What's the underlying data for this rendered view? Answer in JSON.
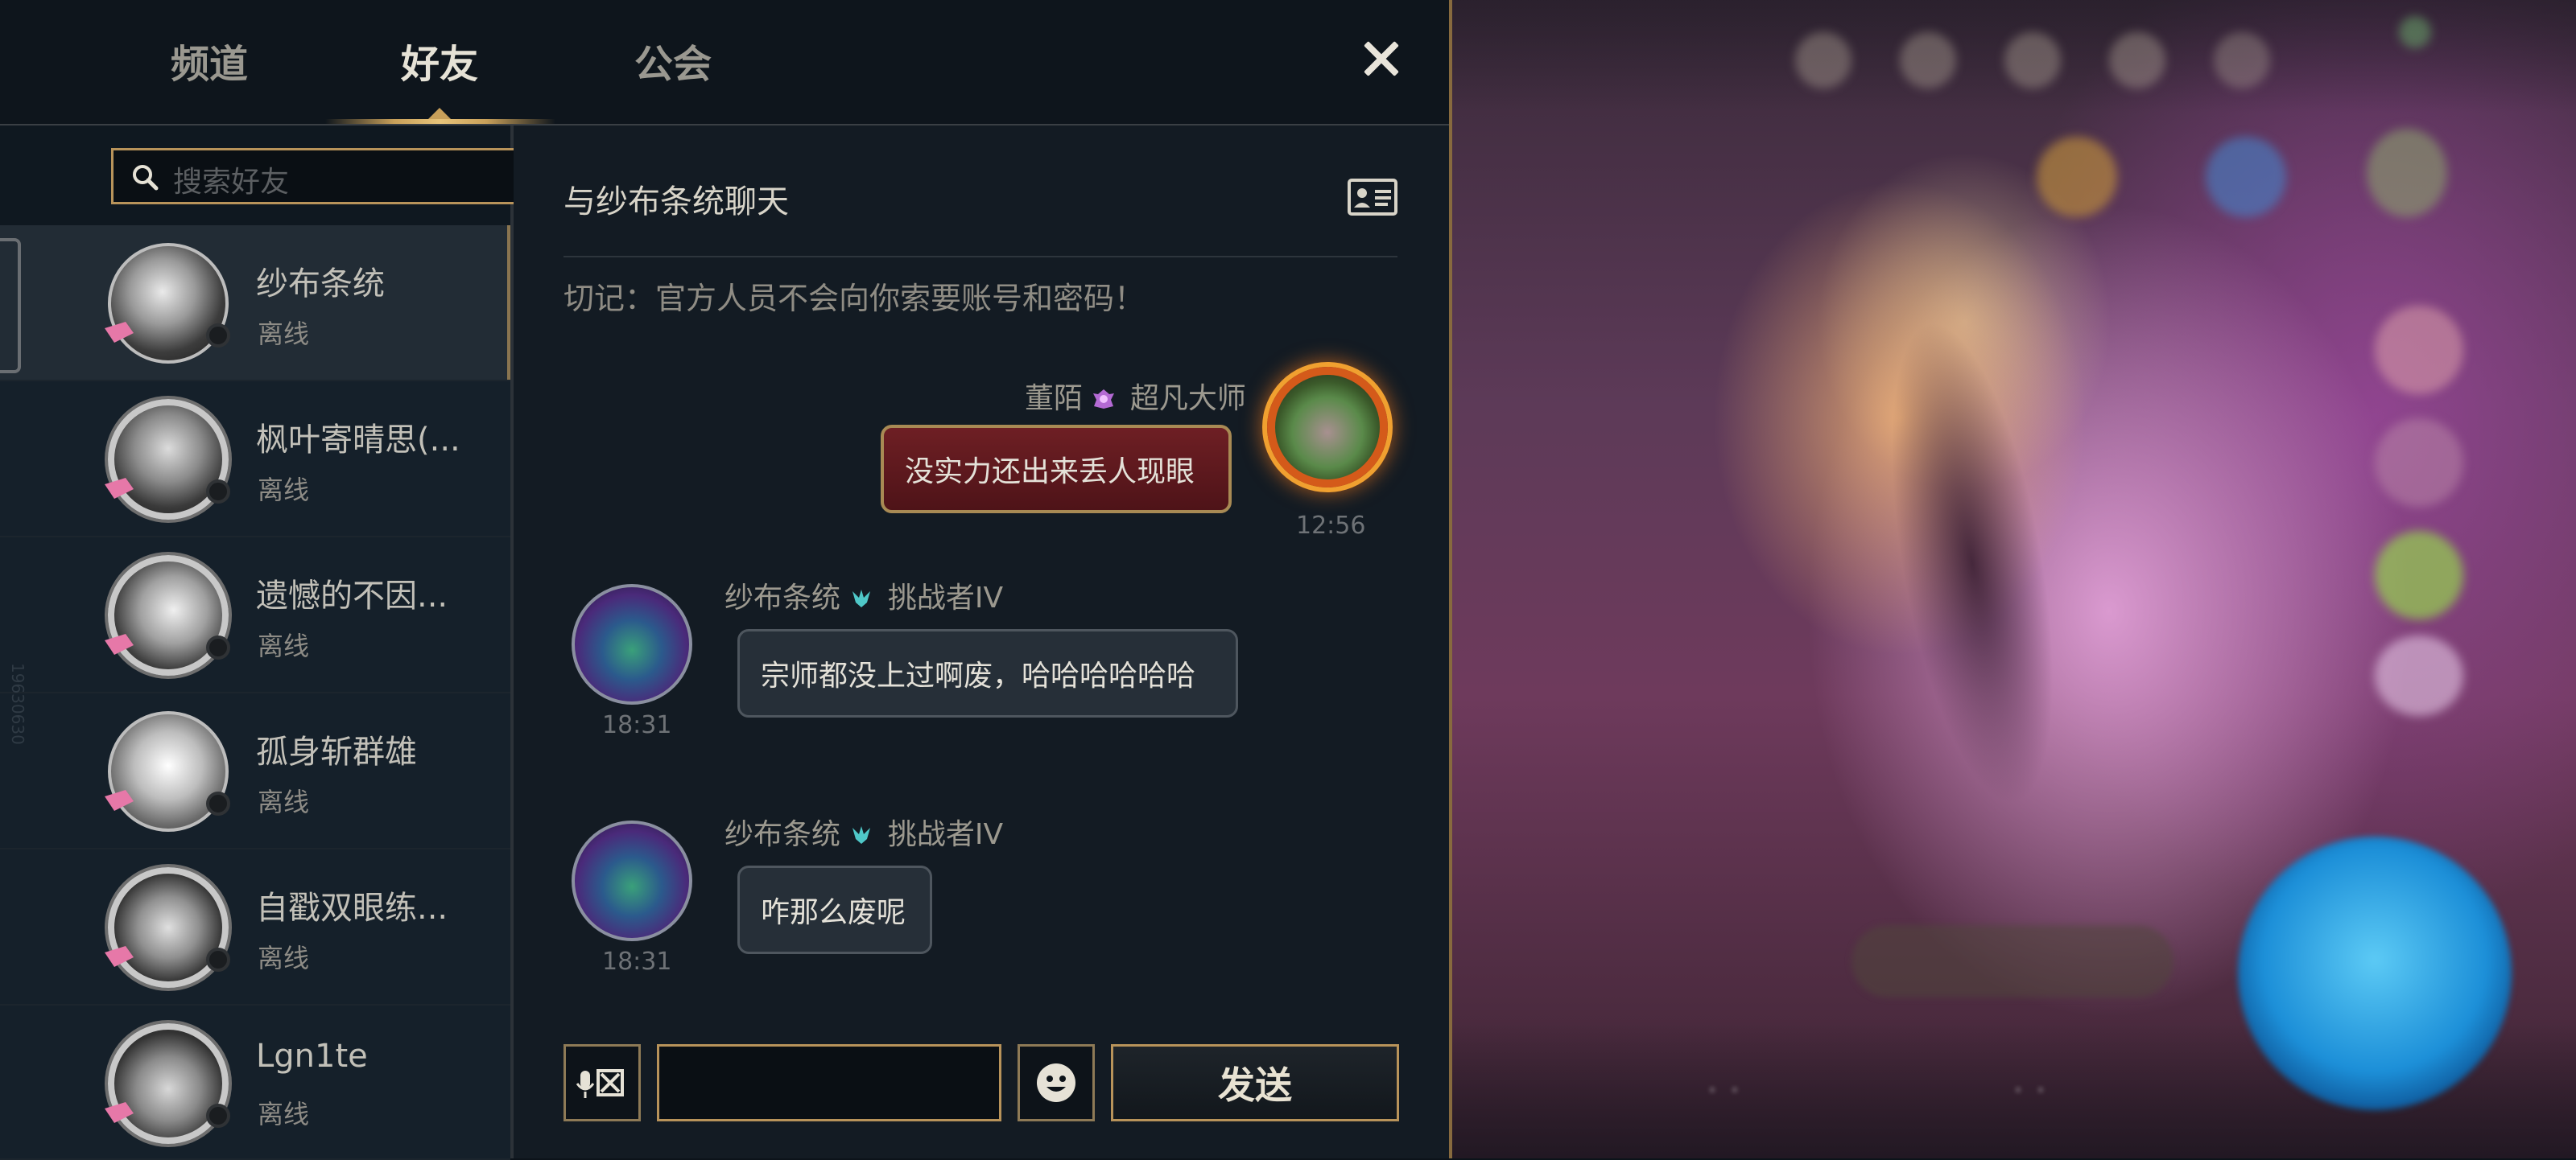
{
  "tabs": [
    {
      "label": "频道"
    },
    {
      "label": "好友"
    },
    {
      "label": "公会"
    }
  ],
  "active_tab": "好友",
  "search": {
    "placeholder": "搜索好友"
  },
  "friends": [
    {
      "name": "纱布条统",
      "status": "离线"
    },
    {
      "name": "枫叶寄晴思(...",
      "status": "离线"
    },
    {
      "name": "遗憾的不因...",
      "status": "离线"
    },
    {
      "name": "孤身斩群雄",
      "status": "离线"
    },
    {
      "name": "自戳双眼练...",
      "status": "离线"
    },
    {
      "name": "Lgn1te",
      "status": "离线"
    }
  ],
  "side_id": "19630630",
  "chat": {
    "title": "与纱布条统聊天",
    "warning": "切记：官方人员不会向你索要账号和密码！",
    "messages": [
      {
        "sender": "董陌",
        "rank": "超凡大师",
        "text": "没实力还出来丢人现眼",
        "time": "12:56"
      },
      {
        "sender": "纱布条统",
        "rank": "挑战者IV",
        "text": "宗师都没上过啊废，哈哈哈哈哈哈",
        "time": "18:31"
      },
      {
        "sender": "纱布条统",
        "rank": "挑战者IV",
        "text": "咋那么废呢",
        "time": "18:31"
      }
    ],
    "send_label": "发送"
  },
  "colors": {
    "accent_gold": "#b8935a",
    "panel_bg": "#111a22",
    "my_bubble": "#6e1f24",
    "their_bubble": "#262f38"
  },
  "icons": [
    "search-icon",
    "close-icon",
    "profile-card-icon",
    "voice-input-icon",
    "emoji-icon",
    "rank-icon"
  ]
}
